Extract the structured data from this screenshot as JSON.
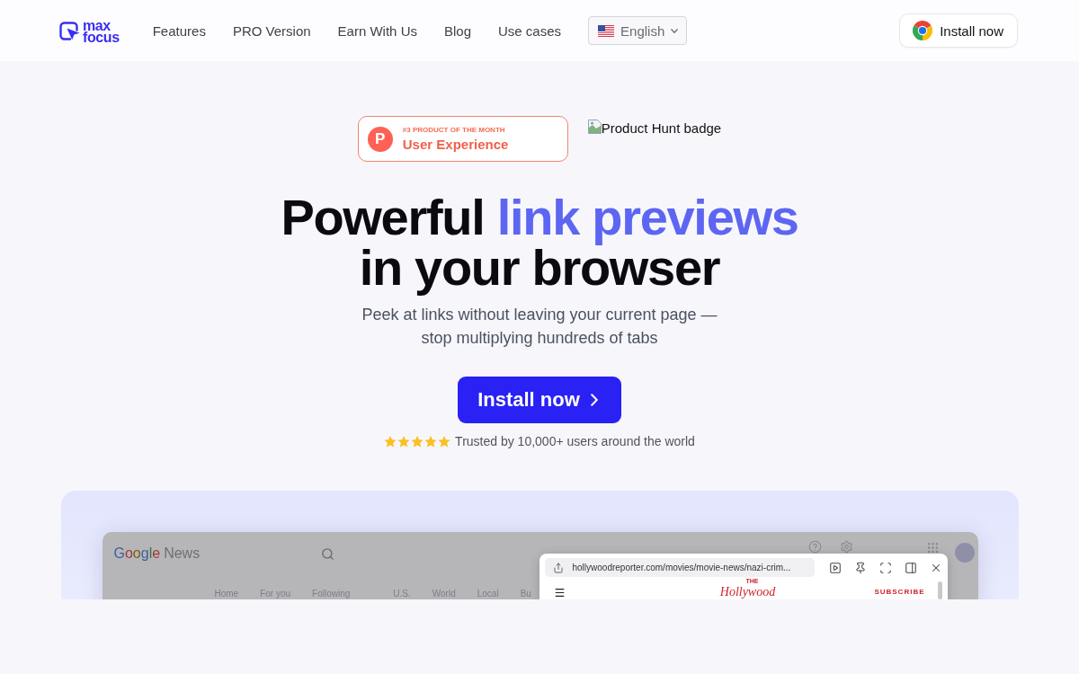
{
  "header": {
    "logo": {
      "line_1": "max",
      "line_2": "focus"
    },
    "nav": [
      {
        "label": "Features"
      },
      {
        "label": "PRO Version"
      },
      {
        "label": "Earn With Us"
      },
      {
        "label": "Blog"
      },
      {
        "label": "Use cases"
      }
    ],
    "language": {
      "label": "English"
    },
    "install_button": {
      "label": "Install now"
    }
  },
  "hero": {
    "award_badge": {
      "logo_letter": "P",
      "rank": "#3 PRODUCT OF THE MONTH",
      "category": "User Experience"
    },
    "broken_image": {
      "alt_text": "Product Hunt badge"
    },
    "headline": {
      "part_1": "Powerful",
      "highlight": "link previews",
      "line_2": "in your browser"
    },
    "subtitle": [
      "Peek at links without leaving your current page —",
      "stop multiplying hundreds of tabs"
    ],
    "cta_button": {
      "label": "Install now"
    },
    "rating": {
      "stars": 5,
      "text": "Trusted by 10,000+ users around the world"
    }
  },
  "demo": {
    "news_app": {
      "logo_brand": "Google",
      "logo_product": "News",
      "nav_groups": [
        [
          {
            "label": "Home"
          },
          {
            "label": "For you"
          },
          {
            "label": "Following"
          }
        ],
        [
          {
            "label": "U.S."
          },
          {
            "label": "World"
          },
          {
            "label": "Local"
          },
          {
            "label": "Bu"
          }
        ]
      ]
    },
    "preview_popup": {
      "url": "hollywoodreporter.com/movies/movie-news/nazi-crim...",
      "site_logo_kicker": "THE",
      "site_logo": "Hollywood",
      "subscribe": "SUBSCRIBE"
    }
  }
}
